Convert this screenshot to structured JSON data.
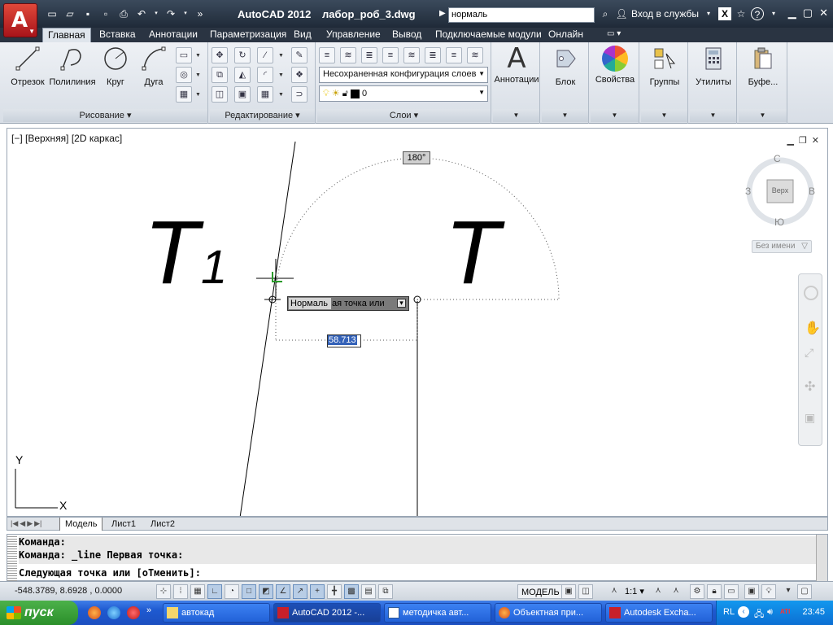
{
  "titlebar": {
    "app_title": "AutoCAD 2012",
    "file_title": "лабор_роб_3.dwg",
    "search_value": "нормаль",
    "signin_label": "Вход в службы"
  },
  "tabs": [
    "Главная",
    "Вставка",
    "Аннотации",
    "Параметризация",
    "Вид",
    "Управление",
    "Вывод",
    "Подключаемые модули",
    "Онлайн"
  ],
  "ribbon": {
    "draw": {
      "title": "Рисование",
      "tools": [
        "Отрезок",
        "Полилиния",
        "Круг",
        "Дуга"
      ]
    },
    "modify": {
      "title": "Редактирование"
    },
    "layers": {
      "title": "Слои",
      "layer_state": "Несохраненная конфигурация слоев",
      "current_layer": "0"
    },
    "big_tools": [
      "Аннотации",
      "Блок",
      "Свойства",
      "Группы",
      "Утилиты",
      "Буфе..."
    ]
  },
  "viewport": {
    "label": "[−] [Верхняя] [2D каркас]",
    "tooltip_selected": "Нормаль",
    "tooltip_rest": "ая точка или",
    "dim_value": "58.713",
    "angle_value": "180°",
    "drawing_labels": [
      "T",
      "1",
      "T"
    ]
  },
  "viewcube": {
    "north": "С",
    "south": "Ю",
    "west": "З",
    "east": "В",
    "face": "Верх",
    "ucs_name": "Без имени"
  },
  "ucs": {
    "x": "X",
    "y": "Y"
  },
  "layout_tabs": [
    "Модель",
    "Лист1",
    "Лист2"
  ],
  "command": {
    "history": [
      "Команда:",
      "Команда: _line Первая точка:"
    ],
    "prompt": "Следующая точка или [оТменить]:"
  },
  "status": {
    "coords": "-548.3789, 8.6928 , 0.0000",
    "model_label": "МОДЕЛЬ",
    "scale": "1:1"
  },
  "taskbar": {
    "start": "пуск",
    "tasks": [
      "автокад",
      "AutoCAD 2012 -...",
      "методичка авт...",
      "Объектная при...",
      "Autodesk Excha..."
    ],
    "lang": "RL",
    "clock": "23:45"
  },
  "colors": {
    "title_bg": "#1f2a38",
    "accent_red": "#c8202a",
    "selection_blue": "#3462b8",
    "taskbar_blue": "#1e59d0",
    "start_green": "#2b8f2a"
  }
}
